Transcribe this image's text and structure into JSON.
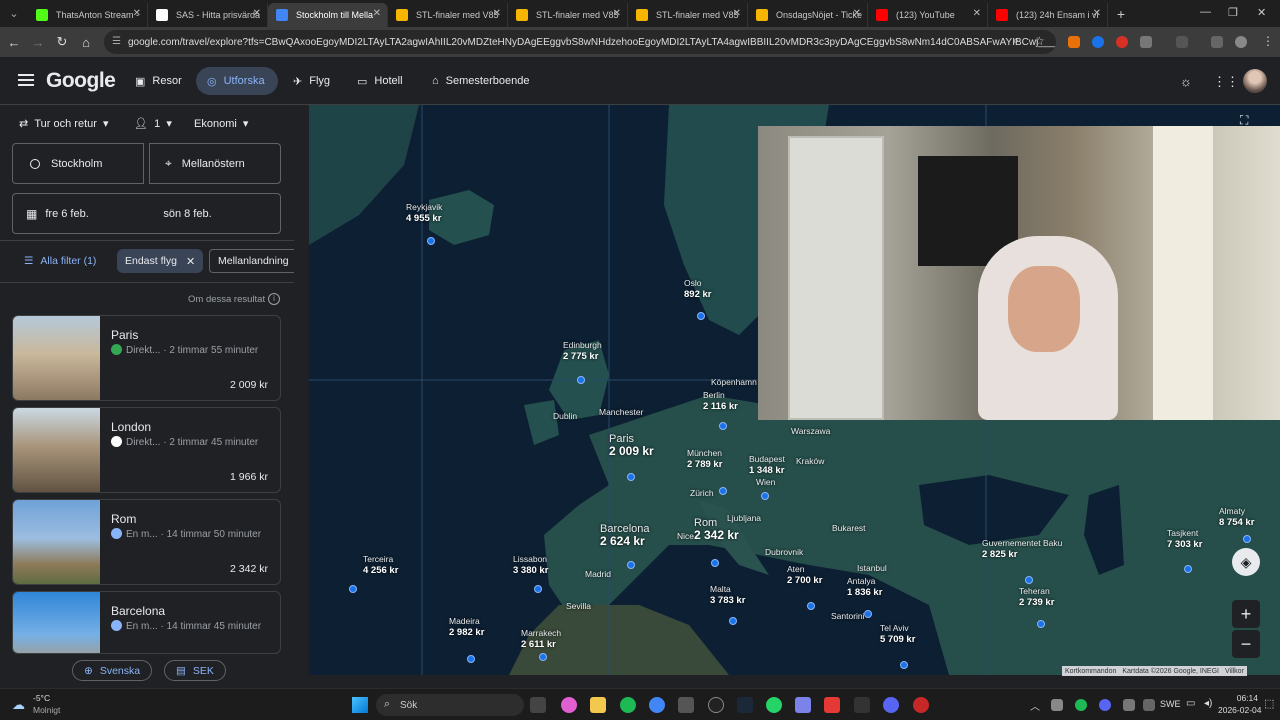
{
  "browser": {
    "tabs": [
      {
        "title": "ThatsAnton Stream -",
        "color": "#53fc18"
      },
      {
        "title": "SAS - Hitta prisvärda",
        "color": "#ffffff"
      },
      {
        "title": "Stockholm till Mella",
        "color": "#4285f4",
        "active": true
      },
      {
        "title": "STL-finaler med V85",
        "color": "#f7b500"
      },
      {
        "title": "STL-finaler med V85",
        "color": "#f7b500"
      },
      {
        "title": "STL-finaler med V85",
        "color": "#f7b500"
      },
      {
        "title": "OnsdagsNöjet - Ticke",
        "color": "#f7b500"
      },
      {
        "title": "(123) YouTube",
        "color": "#ff0000"
      },
      {
        "title": "(123) 24h Ensam i vi",
        "color": "#ff0000"
      }
    ],
    "url": "google.com/travel/explore?tfs=CBwQAxooEgoyMDI2LTAyLTA2agwIAhIIL20vMDZteHNyDAgEEggvbS8wNHdzehooEgoyMDI2LTAyLTA4agwIBBIIL20vMDR3c3pyDAgCEggvbS8wNm14dC0ABSAFwAYIBCwj_________8B..."
  },
  "header": {
    "logo": "Google",
    "nav": [
      {
        "label": "Resor",
        "icon": "luggage-icon"
      },
      {
        "label": "Utforska",
        "icon": "explore-icon",
        "active": true
      },
      {
        "label": "Flyg",
        "icon": "plane-icon"
      },
      {
        "label": "Hotell",
        "icon": "bed-icon"
      },
      {
        "label": "Semesterboende",
        "icon": "house-icon"
      }
    ]
  },
  "search": {
    "trip_type": "Tur och retur",
    "passengers": "1",
    "cabin": "Ekonomi",
    "origin": "Stockholm",
    "destination": "Mellanöstern",
    "depart_date": "fre 6 feb.",
    "return_date": "sön 8 feb."
  },
  "filters": {
    "all_filters": "Alla filter (1)",
    "active_filter": "Endast flyg",
    "layover": "Mellanlandning"
  },
  "results": {
    "about": "Om dessa resultat",
    "items": [
      {
        "name": "Paris",
        "airline_note": "Direkt...",
        "duration": "2 timmar 55 minuter",
        "price": "2 009 kr",
        "icon_color": "#34a853"
      },
      {
        "name": "London",
        "airline_note": "Direkt...",
        "duration": "2 timmar 45 minuter",
        "price": "1 966 kr",
        "icon_color": "#ffffff"
      },
      {
        "name": "Rom",
        "airline_note": "En m...",
        "duration": "14 timmar 50 minuter",
        "price": "2 342 kr",
        "icon_color": "#8ab4f8"
      },
      {
        "name": "Barcelona",
        "airline_note": "En m...",
        "duration": "14 timmar 45 minuter",
        "price": "",
        "icon_color": "#8ab4f8"
      }
    ]
  },
  "footer": {
    "language": "Svenska",
    "currency": "SEK"
  },
  "map": {
    "destinations": [
      {
        "name": "Reykjavik",
        "price": "4 955 kr"
      },
      {
        "name": "Oslo",
        "price": "892 kr"
      },
      {
        "name": "Edinburgh",
        "price": "2 775 kr"
      },
      {
        "name": "Berlin",
        "price": "2 116 kr"
      },
      {
        "name": "Paris",
        "price": "2 009 kr"
      },
      {
        "name": "München",
        "price": "2 789 kr"
      },
      {
        "name": "Budapest",
        "price": "1 348 kr"
      },
      {
        "name": "Barcelona",
        "price": "2 624 kr"
      },
      {
        "name": "Rom",
        "price": "2 342 kr"
      },
      {
        "name": "Terceira",
        "price": "4 256 kr"
      },
      {
        "name": "Lissabon",
        "price": "3 380 kr"
      },
      {
        "name": "Madeira",
        "price": "2 982 kr"
      },
      {
        "name": "Marrakech",
        "price": "2 611 kr"
      },
      {
        "name": "Malta",
        "price": "3 783 kr"
      },
      {
        "name": "Aten",
        "price": "2 700 kr"
      },
      {
        "name": "Antalya",
        "price": "1 836 kr"
      },
      {
        "name": "Tel Aviv",
        "price": "5 709 kr"
      },
      {
        "name": "Guvernementet Baku",
        "price": "2 825 kr"
      },
      {
        "name": "Teheran",
        "price": "2 739 kr"
      },
      {
        "name": "Tasjkent",
        "price": "7 303 kr"
      },
      {
        "name": "Almaty",
        "price": "8 754 kr"
      }
    ],
    "cities": [
      "Köpenhamn",
      "Dublin",
      "Manchester",
      "Warszawa",
      "Zürich",
      "Kraków",
      "Bukarest",
      "Dubrovnik",
      "Madrid",
      "Sevilla",
      "Istanbul",
      "Santorini",
      "Nice",
      "Wien",
      "Ljubljana"
    ],
    "attribution": [
      "Kortkommandon",
      "Kartdata ©2026 Google, INEGI",
      "Villkor"
    ]
  },
  "taskbar": {
    "weather_temp": "-5°C",
    "weather_text": "Molnigt",
    "search_placeholder": "Sök",
    "lang": "SWE",
    "time": "06:14",
    "date": "2026-02-04"
  }
}
